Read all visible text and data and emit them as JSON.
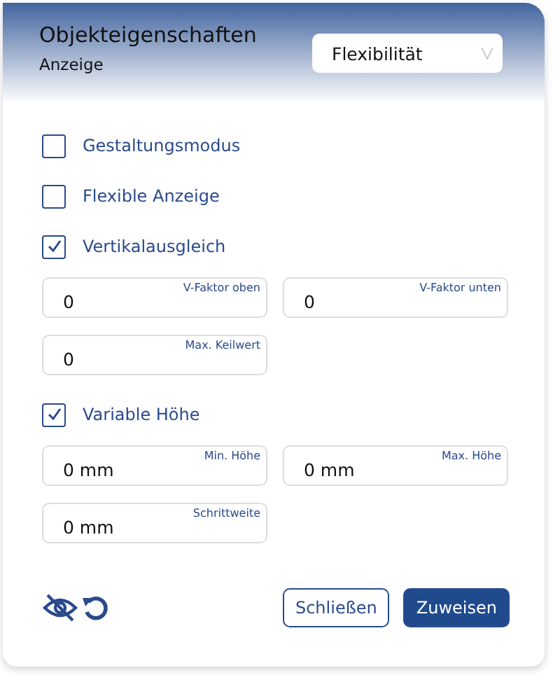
{
  "header": {
    "title": "Objekteigenschaften",
    "subtitle": "Anzeige",
    "dropdown": {
      "value": "Flexibilität"
    }
  },
  "items": [
    {
      "kind": "checkbox",
      "label": "Gestaltungsmodus",
      "checked": false
    },
    {
      "kind": "checkbox",
      "label": "Flexible Anzeige",
      "checked": false
    },
    {
      "kind": "checkbox",
      "label": "Vertikalausgleich",
      "checked": true
    },
    {
      "kind": "fields",
      "fields": [
        {
          "label": "V-Faktor oben",
          "value": "0"
        },
        {
          "label": "V-Faktor unten",
          "value": "0"
        },
        {
          "label": "Max. Keilwert",
          "value": "0"
        }
      ]
    },
    {
      "kind": "checkbox",
      "label": "Variable Höhe",
      "checked": true
    },
    {
      "kind": "fields",
      "fields": [
        {
          "label": "Min. Höhe",
          "value": "0 mm"
        },
        {
          "label": "Max. Höhe",
          "value": "0 mm"
        },
        {
          "label": "Schrittweite",
          "value": "0 mm"
        }
      ]
    }
  ],
  "buttons": [
    {
      "label": "Schließen",
      "kind": "secondary"
    },
    {
      "label": "Zuweisen",
      "kind": "primary"
    }
  ]
}
